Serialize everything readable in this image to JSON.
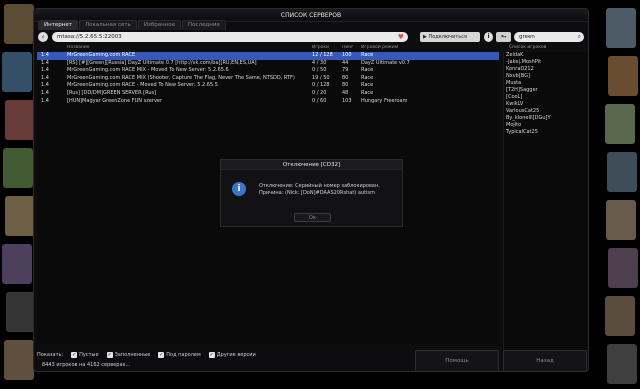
{
  "window": {
    "title": "СПИСОК СЕРВЕРОВ"
  },
  "tabs": [
    {
      "label": "Интернет",
      "active": true
    },
    {
      "label": "Локальная сеть",
      "active": false
    },
    {
      "label": "Избранное",
      "active": false
    },
    {
      "label": "Последние",
      "active": false
    }
  ],
  "toolbar": {
    "address": "mtasa://5.2.65.5:22003",
    "connect_label": "Подключиться",
    "search_value": "green",
    "back_icon": "arrow-left-icon",
    "info_icon": "info-icon"
  },
  "list": {
    "headers": {
      "version": "",
      "name": "Название",
      "players": "Игроки",
      "ping": "Пинг",
      "mode": "Игровой режим"
    },
    "rows": [
      {
        "version": "1.4",
        "name": "MrGreenGaming.com RACE",
        "players": "12 / 128",
        "ping": "100",
        "mode": "Race",
        "selected": true
      },
      {
        "version": "1.4",
        "name": "[RS] [#][Green][Russia] DayZ Ultimate 0.7 [http://vk.com/ba][RU,EN,ES,UA]",
        "players": "4 / 30",
        "ping": "44",
        "mode": "DayZ Ultimate v0.7",
        "selected": false
      },
      {
        "version": "1.4",
        "name": "MrGreenGaming.com RACE MIX - Moved To New Server: 5.2.65.6",
        "players": "0 / 50",
        "ping": "79",
        "mode": "Race",
        "selected": false
      },
      {
        "version": "1.4",
        "name": "MrGreenGaming.com RACE MIX (Shooter, Capture The Flag, Never The Same, NTSDD, RTF)",
        "players": "19 / 50",
        "ping": "80",
        "mode": "Race",
        "selected": false
      },
      {
        "version": "1.4",
        "name": "MrGreenGaming.com RACE - Moved To New Server: 5.2.65.5",
        "players": "0 / 128",
        "ping": "80",
        "mode": "Race",
        "selected": false
      },
      {
        "version": "1.4",
        "name": "[Rus] [DD/DM]GREEN SERVER [Rus]",
        "players": "0 / 20",
        "ping": "48",
        "mode": "Race",
        "selected": false
      },
      {
        "version": "1.4",
        "name": "[HUN]Magyar GreenZone FUN szerver",
        "players": "0 / 60",
        "ping": "103",
        "mode": "Hungary Freeroam",
        "selected": false
      }
    ]
  },
  "players": {
    "header": "Список игроков",
    "names": [
      "ZeldaK",
      "-Jake|.MoshPit",
      "KonraD212",
      "Nxvb[BG]",
      "Musta",
      "[T2H]Sagger",
      "[CooL]",
      "KwikLV",
      "VariousCat25",
      "By_klonelll[DGu]Y",
      "Mojito",
      "TypicalCat25"
    ]
  },
  "dialog": {
    "title": "Отключение [CD32]",
    "icon": "info-icon",
    "line1": "Отключение: Серийный номер заблокирован.",
    "line2": "Причина: (Nick: [DoN]#DAAS20Rshat) autism",
    "ok_label": "Ок"
  },
  "footer": {
    "show_label": "Показать:",
    "filters": [
      {
        "label": "Пустые",
        "checked": true
      },
      {
        "label": "Заполненные",
        "checked": true
      },
      {
        "label": "Под паролем",
        "checked": true
      },
      {
        "label": "Другие версии",
        "checked": true
      }
    ],
    "status": "8443 игроков на 4162 серверах...",
    "back_label": "Назад",
    "help_label": "Помощь"
  }
}
